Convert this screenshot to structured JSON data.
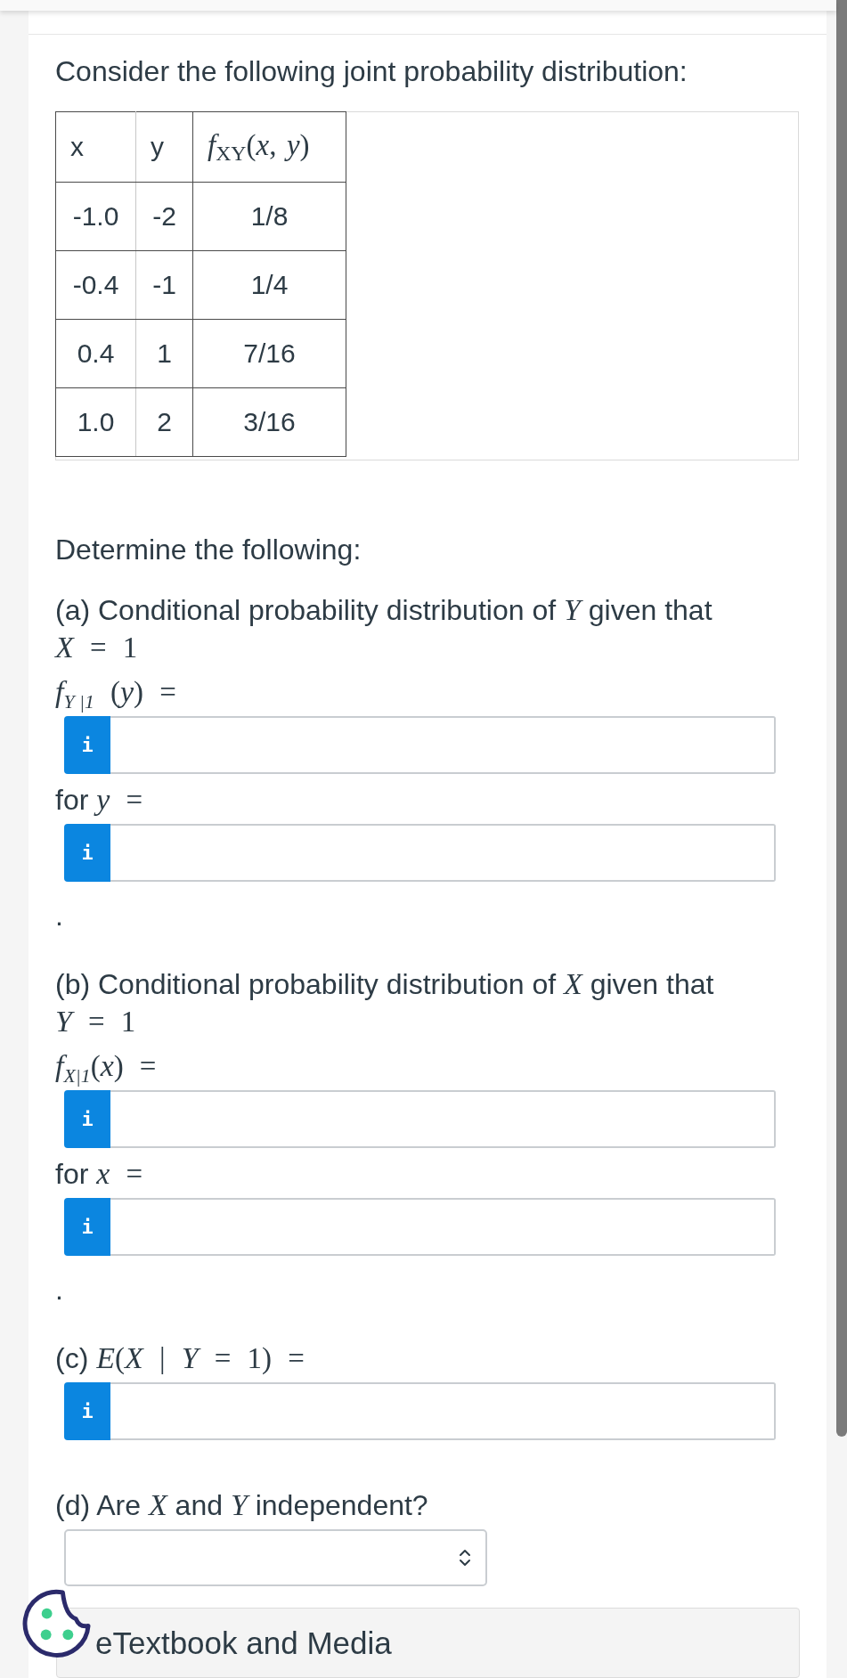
{
  "intro": "Consider the following joint probability distribution:",
  "table": {
    "columns": [
      {
        "kind": "text",
        "label": "x"
      },
      {
        "kind": "text",
        "label": "y"
      },
      {
        "kind": "math",
        "label": "*f*$_{XY}$(*x*, *y*)"
      }
    ],
    "rows": [
      [
        "-1.0",
        "-2",
        "1/8"
      ],
      [
        "-0.4",
        "-1",
        "1/4"
      ],
      [
        "0.4",
        "1",
        "7/16"
      ],
      [
        "1.0",
        "2",
        "3/16"
      ]
    ]
  },
  "instruction": "Determine the following:",
  "parts": [
    {
      "items": [
        {
          "kind": "text",
          "text": "(a) Conditional probability distribution of *Y* given that"
        },
        {
          "kind": "math",
          "text": "*X* = 1"
        },
        {
          "kind": "math",
          "text": "*f*$_{Y |1}$ (*y*) ="
        },
        {
          "kind": "answer",
          "button": "i"
        },
        {
          "kind": "mixed",
          "label": "for",
          "math": "*y* ="
        },
        {
          "kind": "answer",
          "button": "i"
        },
        {
          "kind": "text",
          "text": "."
        }
      ]
    },
    {
      "items": [
        {
          "kind": "text",
          "text": "(b) Conditional probability distribution of *X* given that"
        },
        {
          "kind": "math",
          "text": "*Y* = 1"
        },
        {
          "kind": "math",
          "text": "*f*$_{X|1}$(*x*) ="
        },
        {
          "kind": "answer",
          "button": "i"
        },
        {
          "kind": "mixed",
          "label": "for",
          "math": "*x* ="
        },
        {
          "kind": "answer",
          "button": "i"
        },
        {
          "kind": "text",
          "text": "."
        }
      ]
    },
    {
      "items": [
        {
          "kind": "mixed",
          "label": "(c)",
          "math": "*E*(*X* | *Y* = 1) ="
        },
        {
          "kind": "answer",
          "button": "i"
        }
      ]
    },
    {
      "items": [
        {
          "kind": "text",
          "text": "(d) Are *X* and *Y* independent?"
        },
        {
          "kind": "select"
        }
      ]
    }
  ],
  "resources": {
    "label": "eTextbook and Media"
  }
}
